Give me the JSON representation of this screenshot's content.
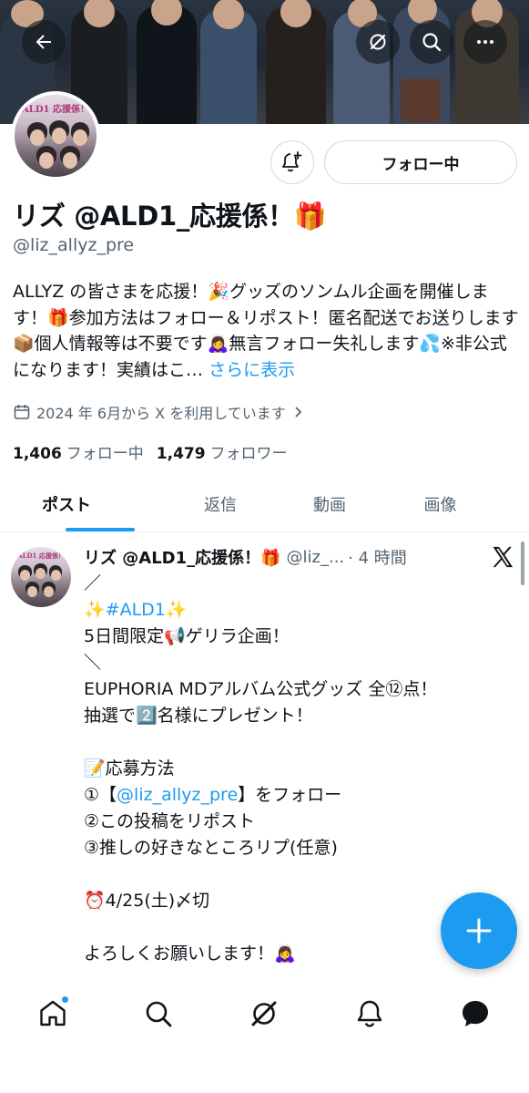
{
  "profile": {
    "display_name": "リズ @ALD1_応援係！🎁",
    "handle": "@liz_allyz_pre",
    "bio": "ALLYZ の皆さまを応援！🎉グッズのソンムル企画を開催します！🎁参加方法はフォロー＆リポスト！匿名配送でお送りします📦個人情報等は不要です🙇‍♀️無言フォロー失礼します💦※非公式になります！実績はこ…",
    "bio_more": "さらに表示",
    "joined": "2024 年 6月から X を利用しています",
    "following_count": "1,406",
    "following_label": "フォロー中",
    "followers_count": "1,479",
    "followers_label": "フォロワー",
    "follow_button": "フォロー中",
    "avatar_text": "ALD1 応援係！"
  },
  "tabs": [
    {
      "label": "ポスト",
      "active": true
    },
    {
      "label": "返信",
      "active": false
    },
    {
      "label": "動画",
      "active": false
    },
    {
      "label": "画像",
      "active": false
    }
  ],
  "post": {
    "author": "リズ @ALD1_応援係！🎁",
    "handle": "@liz_...",
    "time": "· 4 時間",
    "lines": {
      "l1": "／",
      "l2_pre": "✨",
      "l2_tag": "#ALD1",
      "l2_post": "✨",
      "l3": "5日間限定📢ゲリラ企画！",
      "l4": "＼",
      "l5": "EUPHORIA MDアルバム公式グッズ 全⑫点！",
      "l6": "抽選で2️⃣名様にプレゼント！",
      "l7": "📝応募方法",
      "l8_pre": "①【",
      "l8_link": "@liz_allyz_pre",
      "l8_post": "】をフォロー",
      "l9": "②この投稿をリポスト",
      "l10": "③推しの好きなところリプ(任意)",
      "l11": "⏰4/25(土)〆切",
      "l12": "よろしくお願いします！🙇‍♀️"
    }
  },
  "colors": {
    "accent": "#1d9bf0",
    "text": "#0f1419",
    "secondary": "#536471",
    "border": "#cfd9de"
  },
  "icons": {
    "back": "back-arrow-icon",
    "grok": "grok-icon",
    "search": "search-icon",
    "more": "more-icon",
    "notify": "notification-bell-plus-icon",
    "x": "x-logo-icon",
    "compose": "plus-icon",
    "nav": [
      "home-icon",
      "search-icon",
      "grok-icon",
      "notifications-icon",
      "messages-icon"
    ]
  }
}
